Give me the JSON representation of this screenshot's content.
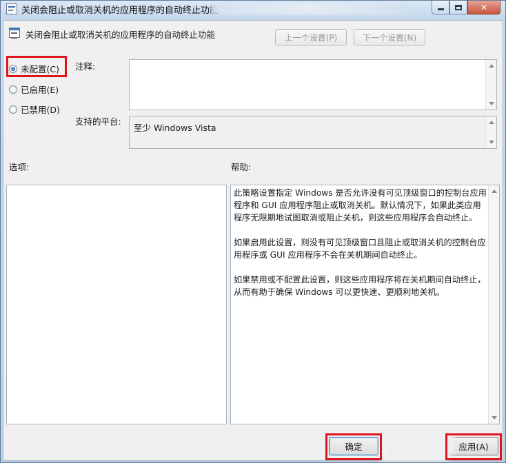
{
  "window": {
    "title": "关闭会阻止或取消关机的应用程序的自动终止功能"
  },
  "header": {
    "title": "关闭会阻止或取消关机的应用程序的自动终止功能",
    "prev_label": "上一个设置(P)",
    "next_label": "下一个设置(N)"
  },
  "radios": [
    {
      "label": "未配置(C)",
      "checked": true
    },
    {
      "label": "已启用(E)",
      "checked": false
    },
    {
      "label": "已禁用(D)",
      "checked": false
    }
  ],
  "comment": {
    "label": "注释:",
    "value": ""
  },
  "platform": {
    "label": "支持的平台:",
    "value": "至少 Windows Vista"
  },
  "options": {
    "label": "选项:"
  },
  "help": {
    "label": "帮助:",
    "paragraphs": [
      "此策略设置指定 Windows 是否允许没有可见顶级窗口的控制台应用程序和 GUI 应用程序阻止或取消关机。默认情况下，如果此类应用程序无限期地试图取消或阻止关机，则这些应用程序会自动终止。",
      "如果启用此设置，则没有可见顶级窗口且阻止或取消关机的控制台应用程序或 GUI 应用程序不会在关机期间自动终止。",
      "如果禁用或不配置此设置，则这些应用程序将在关机期间自动终止，从而有助于确保 Windows 可以更快速、更顺利地关机。"
    ]
  },
  "footer": {
    "ok_label": "确定",
    "apply_label": "应用(A)"
  },
  "colors": {
    "highlight": "#e0141e",
    "chrome": "#c3d6ec",
    "client": "#f0f0f0"
  }
}
